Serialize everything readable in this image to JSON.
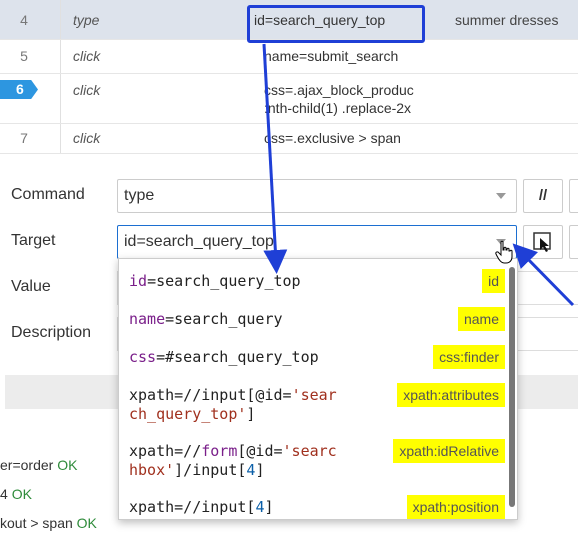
{
  "commands": [
    {
      "num": "4",
      "command": "type",
      "target": "id=search_query_top",
      "value": "summer dresses"
    },
    {
      "num": "5",
      "command": "click",
      "target": "name=submit_search",
      "value": ""
    },
    {
      "num": "6",
      "command": "click",
      "target_line1": "css=.ajax_block_produc",
      "target_line2": ":nth-child(1) .replace-2x",
      "value": ""
    },
    {
      "num": "7",
      "command": "click",
      "target": "css=.exclusive > span",
      "value": ""
    }
  ],
  "form": {
    "command_label": "Command",
    "command_value": "type",
    "comment_btn": "//",
    "target_label": "Target",
    "target_value": "id=search_query_top",
    "value_label": "Value",
    "description_label": "Description"
  },
  "locators": [
    {
      "key": "id",
      "eq": "=",
      "val": "search_query_top",
      "tag": "id"
    },
    {
      "key": "name",
      "eq": "=",
      "val": "search_query",
      "tag": "name"
    },
    {
      "key": "css",
      "eq": "=",
      "val": "#search_query_top",
      "tag": "css:finder"
    },
    {
      "line1a": "xpath=//input[@id=",
      "line1b": "'sear",
      "line2": "ch_query_top'",
      "line2b": "]",
      "tag": "xpath:attributes"
    },
    {
      "line1a": "xpath=//",
      "line1k": "form",
      "line1c": "[@id=",
      "line1s": "'searc",
      "line2s": "hbox'",
      "line2b": "]/input[",
      "line2n": "4",
      "line2c": "]",
      "tag": "xpath:idRelative"
    },
    {
      "line1a": "xpath=//input[",
      "line1n": "4",
      "line1c": "]",
      "tag": "xpath:position"
    }
  ],
  "log": [
    {
      "text": "er=order",
      "status": "OK"
    },
    {
      "text": "4",
      "status": "OK"
    },
    {
      "text": "kout > span",
      "status": "OK"
    }
  ],
  "colors": {
    "highlight": "#ffff00",
    "annotation": "#1f3fd6",
    "selected_row": "#dde3ec",
    "badge": "#2d96e0"
  }
}
